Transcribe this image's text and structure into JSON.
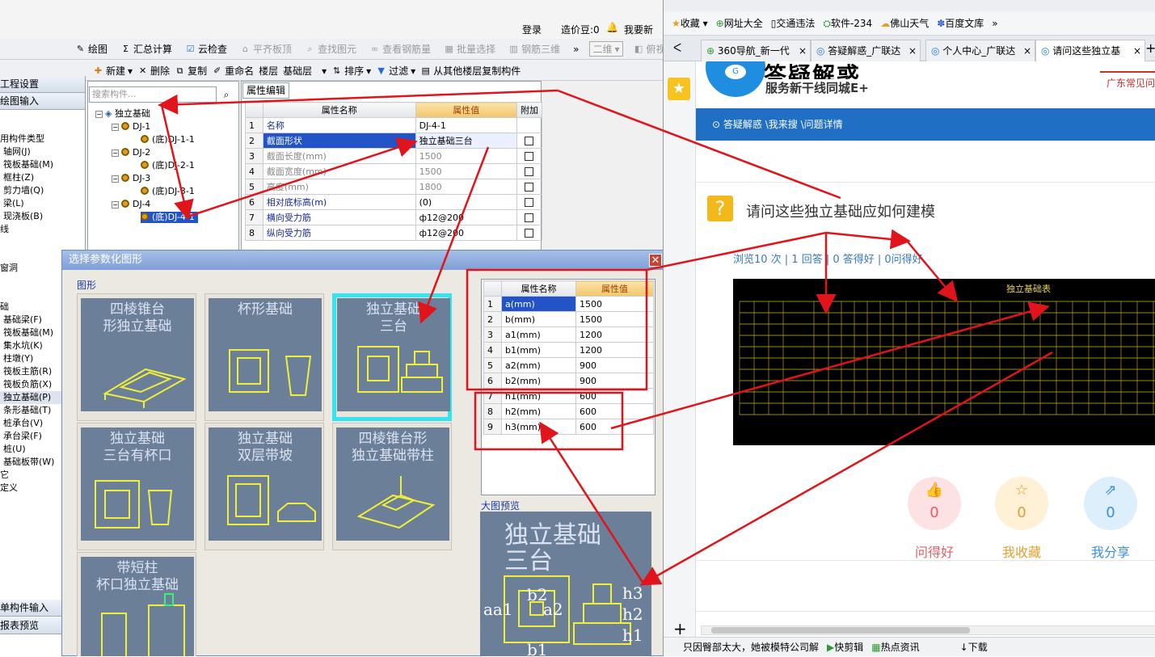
{
  "app": {
    "topbar": {
      "login": "登录",
      "price": "造价豆:0",
      "wiki": "我要新"
    },
    "toolbar1": [
      "绘图",
      "汇总计算",
      "云检查",
      "平齐板顶",
      "查找图元",
      "查看钢筋量",
      "批量选择",
      "钢筋三维",
      "二维",
      "俯视"
    ],
    "toolbar2": {
      "new": "新建",
      "delete": "删除",
      "copy": "复制",
      "rename": "重命名",
      "floor_label": "楼层",
      "floor_value": "基础层",
      "sort": "排序",
      "filter": "过滤",
      "copy_from": "从其他楼层复制构件"
    },
    "sidebar": {
      "headers": [
        "工程设置",
        "绘图输入"
      ],
      "items": [
        "用构件类型",
        "轴网(J)",
        "筏板基础(M)",
        "框柱(Z)",
        "剪力墙(Q)",
        "梁(L)",
        "现浇板(B)",
        "线",
        "",
        "",
        "窗洞",
        "",
        "",
        "础",
        "基础梁(F)",
        "筏板基础(M)",
        "集水坑(K)",
        "柱墩(Y)",
        "筏板主筋(R)",
        "筏板负筋(X)",
        "独立基础(P)",
        "条形基础(T)",
        "桩承台(V)",
        "承台梁(F)",
        "桩(U)",
        "基础板带(W)",
        "它",
        "定义"
      ],
      "bottom": [
        "单构件输入",
        "报表预览"
      ]
    },
    "search_placeholder": "搜索构件...",
    "tree": {
      "root": "独立基础",
      "nodes": [
        {
          "name": "DJ-1",
          "child": "(底)DJ-1-1"
        },
        {
          "name": "DJ-2",
          "child": "(底)DJ-2-1"
        },
        {
          "name": "DJ-3",
          "child": "(底)DJ-3-1"
        },
        {
          "name": "DJ-4",
          "child": "(底)DJ-4-1"
        }
      ]
    },
    "props": {
      "tab": "属性编辑",
      "headers": [
        "属性名称",
        "属性值",
        "附加"
      ],
      "rows": [
        {
          "n": "1",
          "name": "名称",
          "val": "DJ-4-1",
          "chk": false,
          "style": "blue"
        },
        {
          "n": "2",
          "name": "截面形状",
          "val": "独立基础三台",
          "chk": true,
          "style": "sel"
        },
        {
          "n": "3",
          "name": "截面长度(mm)",
          "val": "1500",
          "chk": true,
          "style": "grey"
        },
        {
          "n": "4",
          "name": "截面宽度(mm)",
          "val": "1500",
          "chk": true,
          "style": "grey"
        },
        {
          "n": "5",
          "name": "高度(mm)",
          "val": "1800",
          "chk": true,
          "style": "grey"
        },
        {
          "n": "6",
          "name": "相对底标高(m)",
          "val": "(0)",
          "chk": true,
          "style": "blue"
        },
        {
          "n": "7",
          "name": "横向受力筋",
          "val": "ф12@200",
          "chk": true,
          "style": "blue"
        },
        {
          "n": "8",
          "name": "纵向受力筋",
          "val": "ф12@200",
          "chk": true,
          "style": "blue"
        }
      ]
    },
    "dialog": {
      "title": "选择参数化图形",
      "group_label": "图形",
      "shapes": [
        "四棱锥台\n形独立基础",
        "杯形基础",
        "独立基础\n三台",
        "独立基础\n三台有杯口",
        "独立基础\n双层带坡",
        "四棱锥台形\n独立基础带柱",
        "带短柱\n杯口独立基础"
      ],
      "table_headers": [
        "属性名称",
        "属性值"
      ],
      "params": [
        {
          "n": "1",
          "name": "a(mm)",
          "val": "1500"
        },
        {
          "n": "2",
          "name": "b(mm)",
          "val": "1500"
        },
        {
          "n": "3",
          "name": "a1(mm)",
          "val": "1200"
        },
        {
          "n": "4",
          "name": "b1(mm)",
          "val": "1200"
        },
        {
          "n": "5",
          "name": "a2(mm)",
          "val": "900"
        },
        {
          "n": "6",
          "name": "b2(mm)",
          "val": "900"
        },
        {
          "n": "7",
          "name": "h1(mm)",
          "val": "600"
        },
        {
          "n": "8",
          "name": "h2(mm)",
          "val": "600"
        },
        {
          "n": "9",
          "name": "h3(mm)",
          "val": "600"
        }
      ],
      "preview_label": "大图预览",
      "preview_title": "独立基础\n三台"
    }
  },
  "browser": {
    "bookmarks": [
      "收藏",
      "网址大全",
      "交通违法",
      "软件-234",
      "佛山天气",
      "百度文库"
    ],
    "tabs": [
      "360导航_新一代",
      "答疑解惑_广联达",
      "个人中心_广联达",
      "请问这些独立基"
    ],
    "logo_title": "答疑解惑",
    "logo_sub": "服务新干线同城E+",
    "logo_right": "广东常见问",
    "breadcrumb": "答疑解惑 \\我来搜 \\问题详情",
    "question": "请问这些独立基础应如何建模",
    "stats": "浏览10 次 | 1 回答 | 0 答得好 | 0问得好",
    "drawing_title": "独立基础表",
    "actions": [
      {
        "label": "问得好",
        "count": "0",
        "icon": "thumbs-up-icon",
        "color": "#e0606a",
        "bg": "#fde2e4"
      },
      {
        "label": "我收藏",
        "count": "0",
        "icon": "star-icon",
        "color": "#e0a030",
        "bg": "#fff0d6"
      },
      {
        "label": "我分享",
        "count": "0",
        "icon": "share-icon",
        "color": "#3a8fd8",
        "bg": "#ddeffb"
      }
    ],
    "status": [
      "只因臀部太大，她被模特公司解",
      "快剪辑",
      "热点资讯",
      "下载"
    ]
  }
}
